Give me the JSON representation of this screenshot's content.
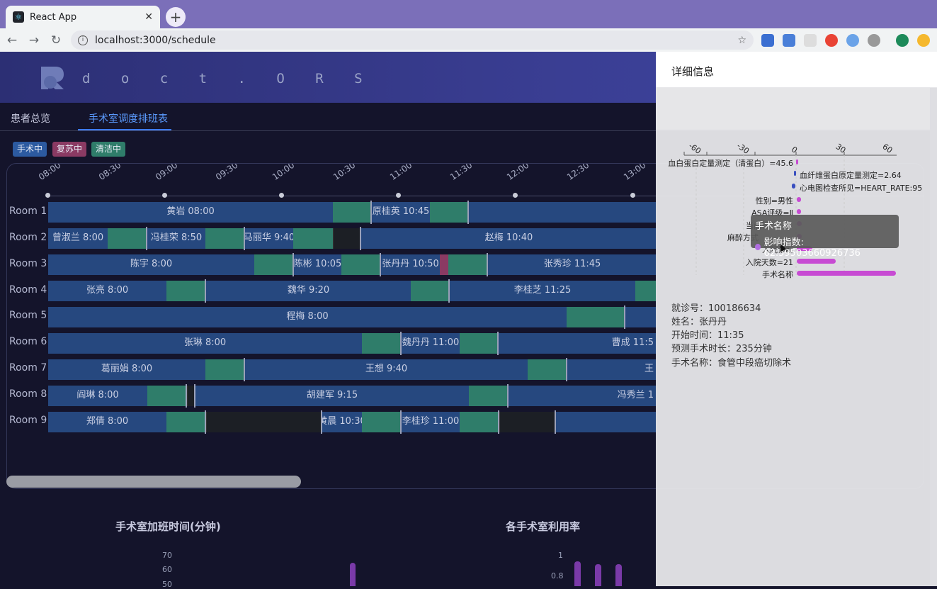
{
  "browser": {
    "tab_title": "React App",
    "url": "localhost:3000/schedule"
  },
  "app": {
    "brand": "d o c t . O R S",
    "nav": [
      "患者总览",
      "手术室调度排班表"
    ],
    "active_nav": 1
  },
  "legend": [
    {
      "label": "手术中",
      "color": "#2c5aa0"
    },
    {
      "label": "复苏中",
      "color": "#8a3a63"
    },
    {
      "label": "清洁中",
      "color": "#2f7d6a"
    }
  ],
  "times": [
    "08:00",
    "08:30",
    "09:00",
    "09:30",
    "10:00",
    "10:30",
    "11:00",
    "11:30",
    "12:00",
    "12:30",
    "13:00"
  ],
  "rooms": [
    "Room 1",
    "Room 2",
    "Room 3",
    "Room 4",
    "Room 5",
    "Room 6",
    "Room 7",
    "Room 8",
    "Room 9"
  ],
  "blocks": [
    {
      "room": 0,
      "label": "黄岩 08:00"
    },
    {
      "room": 0,
      "label": "原桂英 10:45"
    },
    {
      "room": 1,
      "label": "曾淑兰 8:00"
    },
    {
      "room": 1,
      "label": "冯桂荣 8:50"
    },
    {
      "room": 1,
      "label": "马丽华 9:40"
    },
    {
      "room": 1,
      "label": "赵梅 10:40"
    },
    {
      "room": 2,
      "label": "陈宇 8:00"
    },
    {
      "room": 2,
      "label": "陈彬 10:05"
    },
    {
      "room": 2,
      "label": "张丹丹 10:50"
    },
    {
      "room": 2,
      "label": "张秀珍 11:45"
    },
    {
      "room": 3,
      "label": "张亮 8:00"
    },
    {
      "room": 3,
      "label": "魏华 9:20"
    },
    {
      "room": 3,
      "label": "李桂芝 11:25"
    },
    {
      "room": 4,
      "label": "程梅 8:00"
    },
    {
      "room": 5,
      "label": "张琳 8:00"
    },
    {
      "room": 5,
      "label": "魏丹丹 11:00"
    },
    {
      "room": 5,
      "label": "曹成 11:5"
    },
    {
      "room": 6,
      "label": "葛丽娟 8:00"
    },
    {
      "room": 6,
      "label": "王想 9:40"
    },
    {
      "room": 6,
      "label": "王"
    },
    {
      "room": 7,
      "label": "阎琳 8:00"
    },
    {
      "room": 7,
      "label": "胡建军 9:15"
    },
    {
      "room": 7,
      "label": "冯秀兰 1"
    },
    {
      "room": 8,
      "label": "郑倩 8:00"
    },
    {
      "room": 8,
      "label": "黄晨 10:30"
    },
    {
      "room": 8,
      "label": "李桂珍 11:00"
    }
  ],
  "charts": {
    "overtime_title": "手术室加班时间(分钟)",
    "overtime_yticks": [
      "70",
      "60",
      "50"
    ],
    "util_title": "各手术室利用率",
    "util_yticks": [
      "1",
      "0.8"
    ]
  },
  "panel": {
    "title": "详细信息",
    "axis_ticks": [
      "-60",
      "-30",
      "0",
      "30",
      "60"
    ],
    "features": [
      {
        "label": "血白蛋白定量测定（清蛋白）=45.6",
        "value": 1
      },
      {
        "label": "血纤维蛋白原定量测定=2.64",
        "value": -1
      },
      {
        "label": "心电图检查所见=HEART_RATE:95",
        "value": -1
      },
      {
        "label": "性别=男性",
        "value": 2
      },
      {
        "label": "ASA评级=Ⅱ",
        "value": 2
      },
      {
        "label": "当前科",
        "value": 2
      },
      {
        "label": "麻醉方式",
        "value": 2
      },
      {
        "label": "入院诊断",
        "value": 10
      },
      {
        "label": "入院天数=21",
        "value": 25
      },
      {
        "label": "手术名称",
        "value": 62.59503660926736
      }
    ],
    "tooltip": {
      "title": "手术名称",
      "line": "影响指数: 62.59503660926736"
    },
    "info": [
      "就诊号：100186634",
      "姓名：张丹丹",
      "开始时间：11:35",
      "预测手术时长：235分钟",
      "手术名称：食管中段癌切除术"
    ]
  }
}
